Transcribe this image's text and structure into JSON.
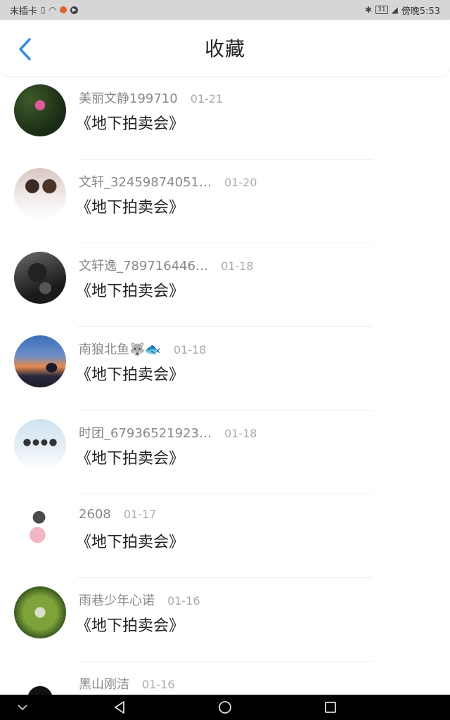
{
  "status_bar": {
    "carrier": "未插卡",
    "time": "傍晚5:53",
    "battery": "31"
  },
  "header": {
    "title": "收藏"
  },
  "items": [
    {
      "author": "美丽文静199710",
      "date": "01-21",
      "title": "《地下拍卖会》"
    },
    {
      "author": "文轩_32459874051…",
      "date": "01-20",
      "title": "《地下拍卖会》"
    },
    {
      "author": "文轩逸_789716446…",
      "date": "01-18",
      "title": "《地下拍卖会》"
    },
    {
      "author": "南狼北鱼🐺🐟",
      "date": "01-18",
      "title": "《地下拍卖会》"
    },
    {
      "author": "时团_67936521923…",
      "date": "01-18",
      "title": "《地下拍卖会》"
    },
    {
      "author": "2608",
      "date": "01-17",
      "title": "《地下拍卖会》"
    },
    {
      "author": "雨巷少年心诺",
      "date": "01-16",
      "title": "《地下拍卖会》"
    },
    {
      "author": "黑山刚洁",
      "date": "01-16",
      "title": ""
    }
  ],
  "colors": {
    "accent": "#2f8fe6",
    "status_bar_bg": "#d6d6d6",
    "nav_bar_bg": "#000000"
  }
}
